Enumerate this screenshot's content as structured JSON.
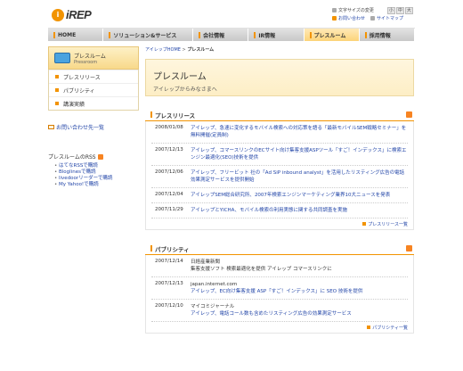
{
  "header": {
    "logo_mark": "i",
    "logo_text": "iREP",
    "font_size_label": "文字サイズの変更",
    "font_sizes": [
      "小",
      "中",
      "大"
    ],
    "contact_label": "お問い合わせ",
    "sitemap_label": "サイトマップ"
  },
  "gnav": {
    "tabs": [
      {
        "label": "HOME"
      },
      {
        "label": "ソリューション&サービス"
      },
      {
        "label": "会社情報"
      },
      {
        "label": "IR情報"
      },
      {
        "label": "プレスルーム"
      },
      {
        "label": "採用情報"
      }
    ]
  },
  "sidebar": {
    "title": "プレスルーム",
    "subtitle": "Pressroom",
    "items": [
      {
        "label": "プレスリリース"
      },
      {
        "label": "パブリシティ"
      },
      {
        "label": "講演実績"
      }
    ],
    "contact": "お問い合わせ先一覧",
    "rss_title": "プレスルームのRSS",
    "rss_links": [
      "はてなRSSで購読",
      "Bloglinesで購読",
      "livedoorリーダーで購読",
      "My Yahoo!で購読"
    ]
  },
  "main": {
    "breadcrumb_home": "アイレップHOME",
    "breadcrumb_sep": ">",
    "breadcrumb_current": "プレスルーム",
    "title": "プレスルーム",
    "subtitle": "アイレップからみなさまへ",
    "press": {
      "heading": "プレスリリース",
      "more": "プレスリリース一覧",
      "rows": [
        {
          "date": "2008/01/08",
          "text": "アイレップ、急速に変化するモバイル検索への対応策を語る「最新モバイルSEM戦略セミナー」を無料開催(定員制)"
        },
        {
          "date": "2007/12/13",
          "text": "アイレップ、コマースリンクのECサイト向け集客支援ASPツール「すご！インデックス」に検索エンジン最適化(SEO)技術を提供"
        },
        {
          "date": "2007/12/06",
          "text": "アイレップ、フリービット 社の「Ad SiP inbound analyst」を活用したリスティング広告の電話効果測定サービスを提供開始"
        },
        {
          "date": "2007/12/04",
          "text": "アイレップSEM総合研究所、2007年検索エンジンマーケティング業界10大ニュースを発表"
        },
        {
          "date": "2007/11/29",
          "text": "アイレップとYICHA、モバイル検索の利用実態に関する共同調査を実施"
        }
      ]
    },
    "publicity": {
      "heading": "パブリシティ",
      "more": "パブリシティ一覧",
      "rows": [
        {
          "date": "2007/12/14",
          "source": "日経産業新聞",
          "text": "集客支援ソフト 検索最適化を提供 アイレップ コマースリンクに"
        },
        {
          "date": "2007/12/13",
          "source": "japan.internet.com",
          "text": "アイレップ、EC向け集客支援 ASP「すご！インデックス」に SEO 技術を提供"
        },
        {
          "date": "2007/12/10",
          "source": "マイコミジャーナル",
          "text": "アイレップ、電話コール数も含めたリスティング広告の効果測定サービス"
        }
      ]
    }
  }
}
